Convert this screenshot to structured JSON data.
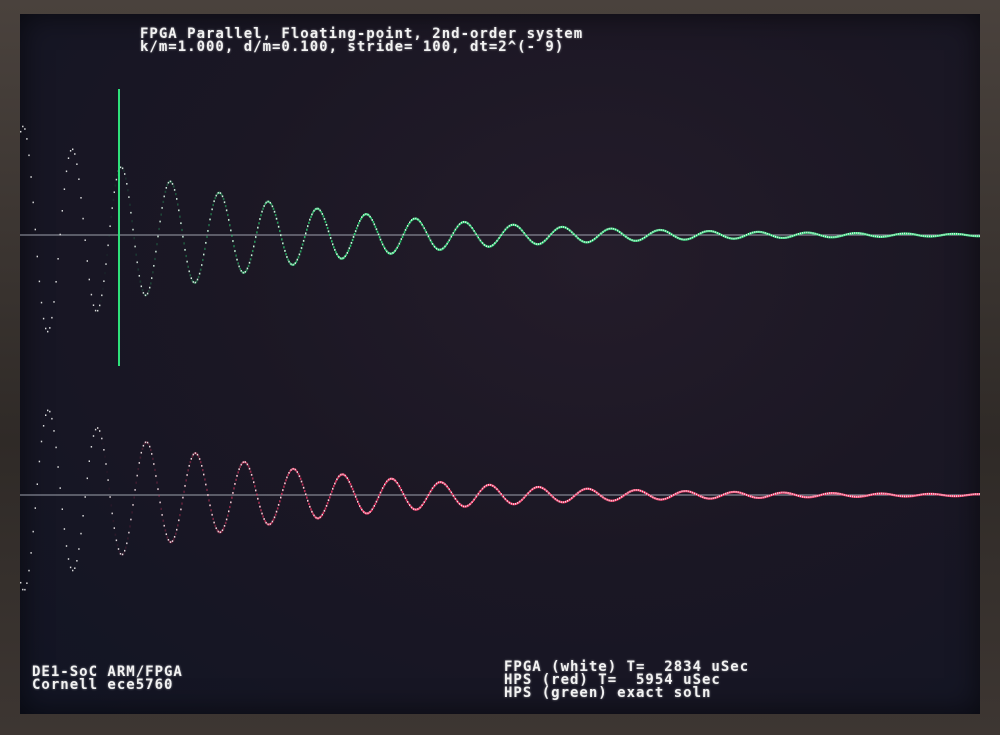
{
  "header": {
    "title": "FPGA Parallel, Floating-point, 2nd-order system",
    "params": "k/m=1.000, d/m=0.100, stride= 100, dt=2^(- 9)"
  },
  "footer_left": {
    "line1": "DE1-SoC ARM/FPGA",
    "line2": "Cornell ece5760"
  },
  "footer_right": {
    "line1": "FPGA (white) T=  2834 uSec",
    "line2": "HPS (red) T=  5954 uSec",
    "line3": "HPS (green) exact soln"
  },
  "colors": {
    "fpga_trace": "#f0f0f0",
    "hps_trace": "#ff3b6b",
    "exact_trace": "#2ee07a",
    "cursor": "#2ee07a",
    "baseline": "#bfc4d0"
  },
  "chart_data": [
    {
      "type": "line",
      "series": [
        {
          "name": "FPGA (white)",
          "function": "damped_oscillation",
          "k_m": 1.0,
          "d_m": 0.1
        },
        {
          "name": "HPS (green) exact soln",
          "function": "damped_oscillation",
          "k_m": 1.0,
          "d_m": 0.1
        }
      ],
      "cursor": true,
      "grid": false
    },
    {
      "type": "line",
      "series": [
        {
          "name": "FPGA (white)",
          "function": "damped_oscillation",
          "k_m": 1.0,
          "d_m": 0.1
        },
        {
          "name": "HPS (red)",
          "function": "damped_oscillation",
          "k_m": 1.0,
          "d_m": 0.1
        }
      ],
      "grid": false
    }
  ]
}
